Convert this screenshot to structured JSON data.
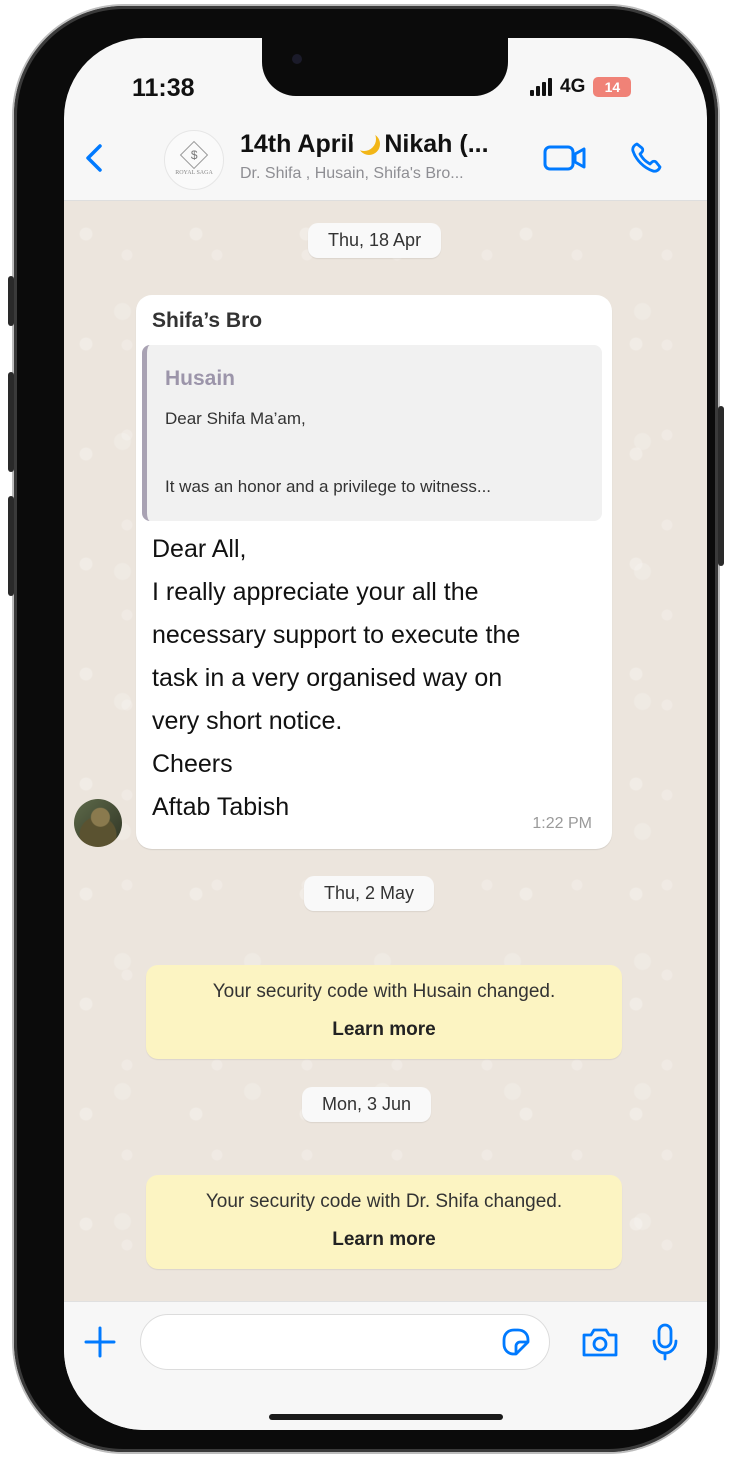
{
  "status": {
    "time": "11:38",
    "network": "4G",
    "battery": "14"
  },
  "header": {
    "title_part1": "14th April",
    "title_part2": "Nikah (...",
    "subtitle": "Dr. Shifa , Husain, Shifa's Bro...",
    "avatar_text": "ROYAL SAGA"
  },
  "chat": {
    "dates": [
      "Thu, 18 Apr",
      "Thu, 2 May",
      "Mon, 3 Jun"
    ],
    "message": {
      "sender": "Shifa’s Bro",
      "quote_author": "Husain",
      "quote_line1": "Dear Shifa Ma’am,",
      "quote_line2": "It was an honor and a privilege to witness...",
      "lines": [
        "Dear All,",
        "I really appreciate your all the",
        "necessary support to execute the",
        "task in a very organised way on",
        "very short notice.",
        "Cheers",
        "Aftab Tabish"
      ],
      "time": "1:22 PM"
    },
    "system_notices": [
      {
        "text": "Your security code with Husain changed.",
        "link": "Learn more"
      },
      {
        "text": "Your security code with Dr. Shifa  changed.",
        "link": "Learn more"
      }
    ]
  },
  "input": {
    "placeholder": ""
  },
  "colors": {
    "accent": "#007aff",
    "notice_bg": "#fcf4c2",
    "chat_bg": "#ece5dd",
    "battery_low": "#f08277"
  },
  "icons": [
    "back-icon",
    "video-call-icon",
    "phone-icon",
    "plus-icon",
    "sticker-icon",
    "camera-icon",
    "microphone-icon"
  ]
}
